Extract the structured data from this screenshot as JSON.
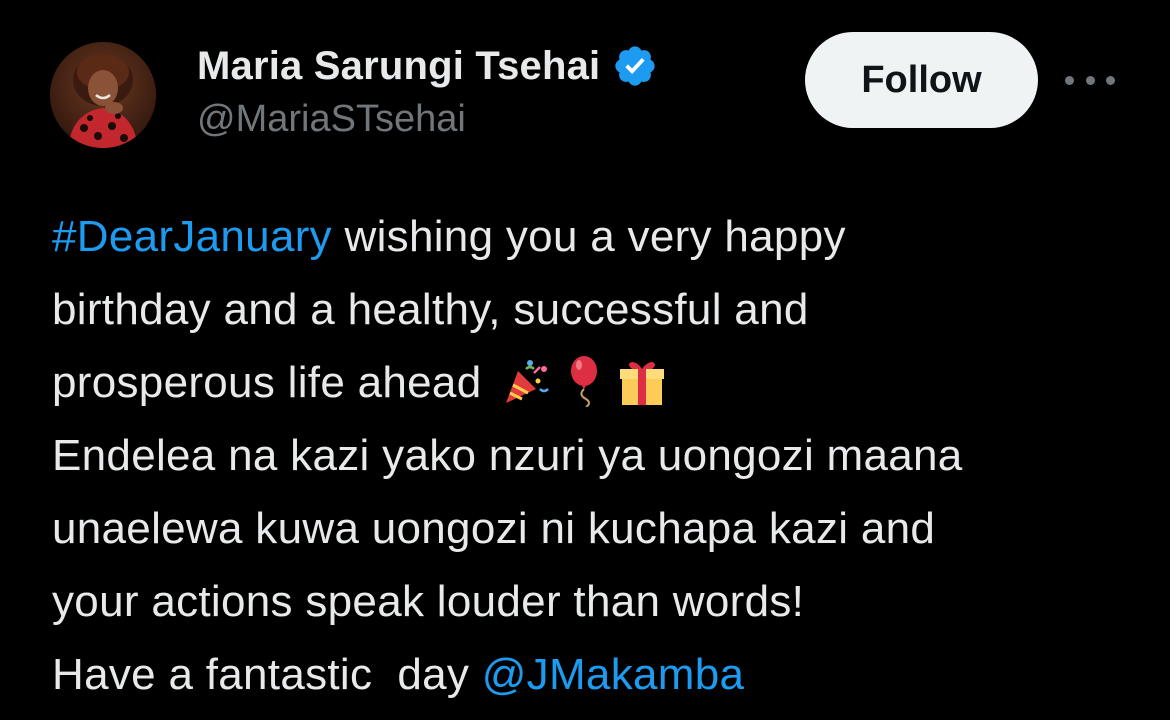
{
  "author": {
    "display_name": "Maria Sarungi Tsehai",
    "handle": "@MariaSTsehai",
    "verified_icon": "verified-badge-icon",
    "avatar": "profile-photo"
  },
  "actions": {
    "follow_label": "Follow",
    "more_icon": "more-options-icon"
  },
  "tweet": {
    "hashtag": "#DearJanuary",
    "line1_rest": " wishing you a very happy",
    "line2": "birthday and a healthy, successful and",
    "line3": "prosperous life ahead ",
    "emojis": [
      "party-popper-icon",
      "balloon-icon",
      "gift-icon"
    ],
    "line4": "Endelea na kazi yako nzuri ya uongozi maana",
    "line5": "unaelewa kuwa uongozi ni kuchapa kazi and",
    "line6": "your actions speak louder than words!",
    "line7_pre": "Have a fantastic  day ",
    "mention": "@JMakamba"
  },
  "colors": {
    "background": "#000000",
    "text": "#e7e9ea",
    "secondary_text": "#71767b",
    "link": "#1d9bf0",
    "verified": "#1d9bf0",
    "follow_bg": "#eff3f4"
  }
}
